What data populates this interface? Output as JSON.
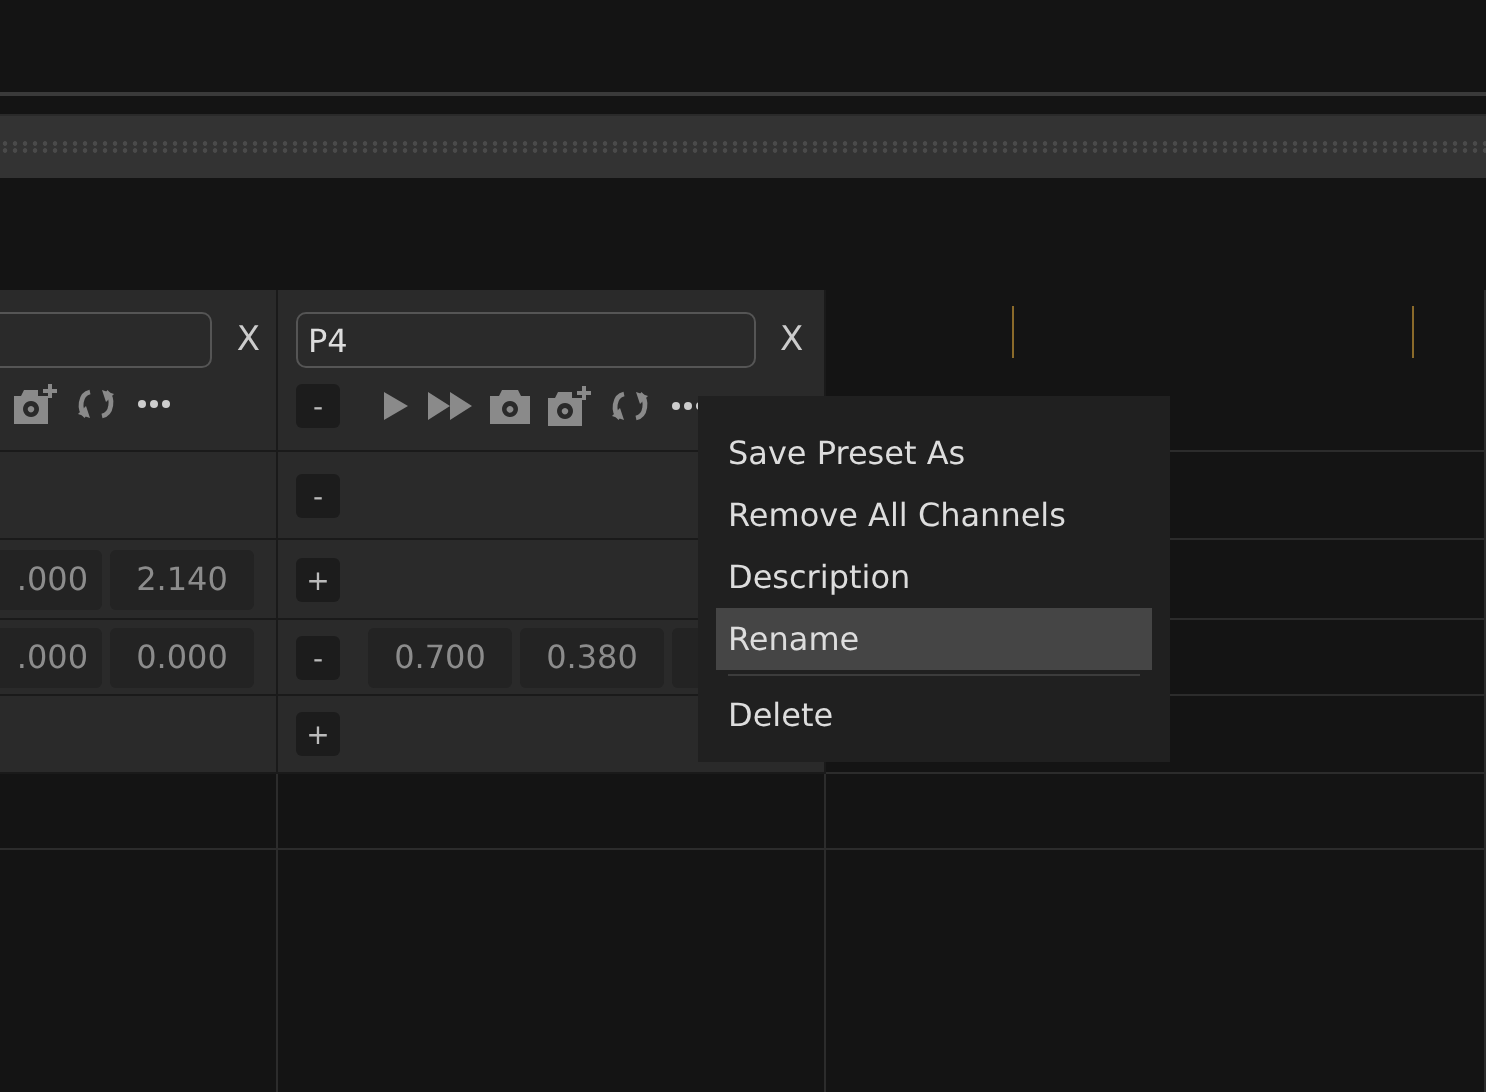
{
  "presets": [
    {
      "close_label": "X",
      "toolbar": [
        {
          "kind": "camera-plus"
        },
        {
          "kind": "cycle"
        },
        {
          "kind": "more"
        }
      ],
      "rows": [
        {
          "values": []
        },
        {
          "values": [
            ".000",
            "2.140"
          ]
        },
        {
          "values": [
            ".000",
            "0.000"
          ]
        },
        {
          "values": []
        }
      ]
    },
    {
      "name": "P4",
      "close_label": "X",
      "toolbar": [
        {
          "kind": "minus",
          "label": "-"
        },
        {
          "kind": "play"
        },
        {
          "kind": "fast-forward"
        },
        {
          "kind": "camera"
        },
        {
          "kind": "camera-plus"
        },
        {
          "kind": "cycle"
        },
        {
          "kind": "more"
        }
      ],
      "rows": [
        {
          "button": "-",
          "values": []
        },
        {
          "button": "+",
          "values": []
        },
        {
          "button": "-",
          "values": [
            "0.700",
            "0.380"
          ],
          "hidden_cell": true
        },
        {
          "button": "+",
          "values": []
        }
      ]
    }
  ],
  "context_menu": [
    {
      "kind": "item",
      "label": "Save Preset As",
      "selected": false
    },
    {
      "kind": "item",
      "label": "Remove All Channels",
      "selected": false
    },
    {
      "kind": "item",
      "label": "Description",
      "selected": false
    },
    {
      "kind": "item",
      "label": "Rename",
      "selected": true
    },
    {
      "kind": "separator"
    },
    {
      "kind": "item",
      "label": "Delete",
      "selected": false
    }
  ]
}
